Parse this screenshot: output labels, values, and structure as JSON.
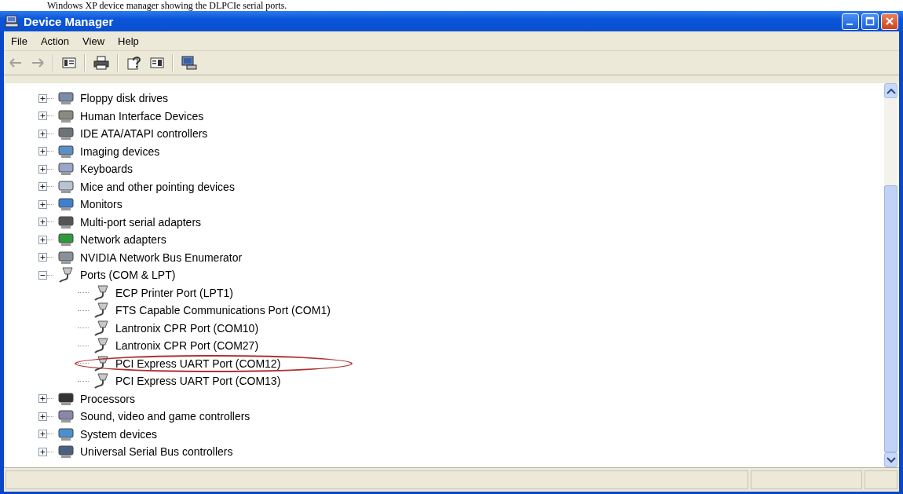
{
  "caption": "Windows XP device manager showing the DLPCIe serial ports.",
  "window": {
    "title": "Device Manager"
  },
  "menu": [
    "File",
    "Action",
    "View",
    "Help"
  ],
  "tree": [
    {
      "label": "Floppy disk drives",
      "expanded": false
    },
    {
      "label": "Human Interface Devices",
      "expanded": false
    },
    {
      "label": "IDE ATA/ATAPI controllers",
      "expanded": false
    },
    {
      "label": "Imaging devices",
      "expanded": false
    },
    {
      "label": "Keyboards",
      "expanded": false
    },
    {
      "label": "Mice and other pointing devices",
      "expanded": false
    },
    {
      "label": "Monitors",
      "expanded": false
    },
    {
      "label": "Multi-port serial adapters",
      "expanded": false
    },
    {
      "label": "Network adapters",
      "expanded": false
    },
    {
      "label": "NVIDIA Network Bus Enumerator",
      "expanded": false
    },
    {
      "label": "Ports (COM & LPT)",
      "expanded": true,
      "children": [
        {
          "label": "ECP Printer Port (LPT1)",
          "circled": false
        },
        {
          "label": "FTS Capable Communications Port (COM1)",
          "circled": false
        },
        {
          "label": "Lantronix CPR Port (COM10)",
          "circled": false
        },
        {
          "label": "Lantronix CPR Port (COM27)",
          "circled": false
        },
        {
          "label": "PCI Express UART Port (COM12)",
          "circled": true
        },
        {
          "label": "PCI Express UART Port (COM13)",
          "circled": false
        }
      ]
    },
    {
      "label": "Processors",
      "expanded": false
    },
    {
      "label": "Sound, video and game controllers",
      "expanded": false
    },
    {
      "label": "System devices",
      "expanded": false
    },
    {
      "label": "Universal Serial Bus controllers",
      "expanded": false
    }
  ]
}
